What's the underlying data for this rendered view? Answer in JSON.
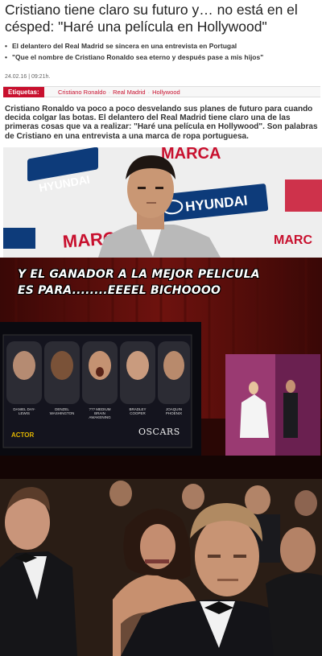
{
  "article": {
    "headline": "Cristiano tiene claro su futuro y… no está en el césped: \"Haré una película en Hollywood\"",
    "bullets": [
      "El delantero del Real Madrid se sincera en una entrevista en Portugal",
      "\"Que el nombre de Cristiano Ronaldo sea eterno y después pase a mis hijos\""
    ],
    "dateline": "24.02.16 | 09:21h.",
    "tags_label": "Etiquetas:",
    "tags": [
      "Cristiano Ronaldo",
      "Real Madrid",
      "Hollywood"
    ],
    "lead": "Cristiano Ronaldo va poco a poco desvelando sus planes de futuro para cuando decida colgar las botas. El delantero del Real Madrid tiene claro una de las primeras cosas que va a realizar: \"Haré una película en Hollywood\". Son palabras de Cristiano en una entrevista a una marca de ropa portuguesa."
  },
  "photo1": {
    "backdrop_words": [
      "MARCA",
      "HYUNDAI",
      "MARCA",
      "HYUNDAI",
      "MARC"
    ]
  },
  "meme": {
    "caption_line1": "Y EL GANADOR A LA MEJOR PELICULA",
    "caption_line2": "ES PARA........EEEEL BICHOOOO",
    "nominees": [
      {
        "name": "DANIEL DAY-LEWIS"
      },
      {
        "name": "DENZEL WASHINGTON"
      },
      {
        "name": "??? Medium Brain Awakening"
      },
      {
        "name": "BRADLEY COOPER"
      },
      {
        "name": "JOAQUIN PHOENIX"
      }
    ],
    "category": "ACTOR",
    "show": "OSCARS"
  },
  "colors": {
    "accent_red": "#c8102e",
    "stage_red": "#7a1410",
    "gold": "#e0b400"
  }
}
